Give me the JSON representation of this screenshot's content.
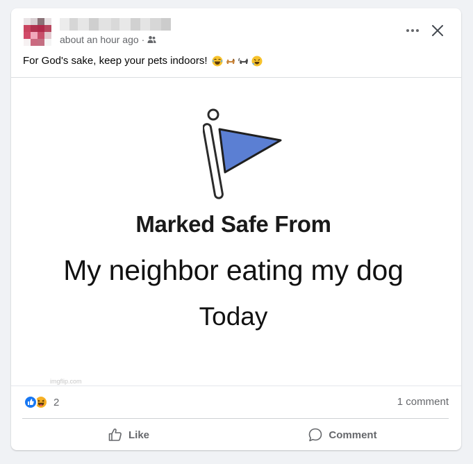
{
  "post": {
    "timestamp": "about an hour ago",
    "separator": "·",
    "audience_icon": "friends-icon",
    "text": "For God's sake, keep your pets indoors!",
    "emojis": [
      "laughing-emoji",
      "dog-emoji",
      "cat-emoji",
      "rofl-emoji"
    ]
  },
  "header_actions": {
    "more_icon": "more-icon",
    "close_icon": "close-icon"
  },
  "meme": {
    "line1": "Marked Safe From",
    "line2": "My neighbor eating my dog",
    "line3": "Today",
    "watermark": "imgflip.com",
    "flag_color": "#5b7fd3"
  },
  "engagement": {
    "reaction_icons": [
      "like-icon",
      "haha-icon"
    ],
    "reaction_count": "2",
    "comment_count": "1 comment"
  },
  "actions": {
    "like_label": "Like",
    "comment_label": "Comment"
  },
  "colors": {
    "accent": "#1877f2",
    "secondary_text": "#65676b",
    "haha": "#f7b125"
  }
}
